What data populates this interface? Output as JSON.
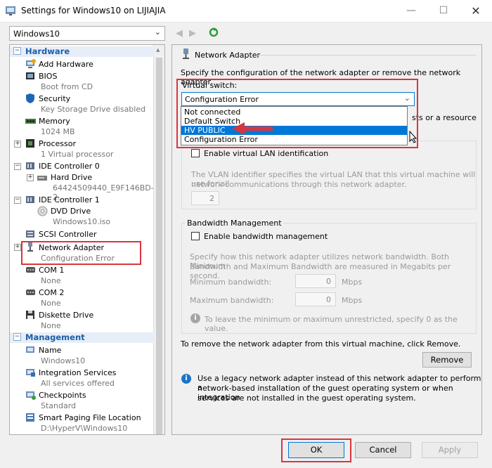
{
  "window": {
    "title": "Settings for Windows10 on LIJIAJIA"
  },
  "vm_selector": {
    "value": "Windows10"
  },
  "tree": {
    "hardware_label": "Hardware",
    "management_label": "Management",
    "items": [
      {
        "label": "Add Hardware",
        "sub": ""
      },
      {
        "label": "BIOS",
        "sub": "Boot from CD"
      },
      {
        "label": "Security",
        "sub": "Key Storage Drive disabled"
      },
      {
        "label": "Memory",
        "sub": "1024 MB"
      },
      {
        "label": "Processor",
        "sub": "1 Virtual processor"
      },
      {
        "label": "IDE Controller 0",
        "sub": ""
      },
      {
        "label": "Hard Drive",
        "sub": "64424509440_E9F146BD-2..."
      },
      {
        "label": "IDE Controller 1",
        "sub": ""
      },
      {
        "label": "DVD Drive",
        "sub": "Windows10.iso"
      },
      {
        "label": "SCSI Controller",
        "sub": ""
      },
      {
        "label": "Network Adapter",
        "sub": "Configuration Error"
      },
      {
        "label": "COM 1",
        "sub": "None"
      },
      {
        "label": "COM 2",
        "sub": "None"
      },
      {
        "label": "Diskette Drive",
        "sub": "None"
      }
    ],
    "mgmt_items": [
      {
        "label": "Name",
        "sub": "Windows10"
      },
      {
        "label": "Integration Services",
        "sub": "All services offered"
      },
      {
        "label": "Checkpoints",
        "sub": "Standard"
      },
      {
        "label": "Smart Paging File Location",
        "sub": "D:\\HyperV\\Windows10"
      }
    ]
  },
  "panel": {
    "section_title": "Network Adapter",
    "description": "Specify the configuration of the network adapter or remove the network adapter.",
    "virtual_switch_label": "Virtual switch:",
    "virtual_switch_value": "Configuration Error",
    "dropdown_options": [
      "Not connected",
      "Default Switch",
      "HV PUBLIC",
      "Configuration Error"
    ],
    "dropdown_selected": "HV PUBLIC",
    "hidden_text_fragment": "sts or a resource",
    "vlan_checkbox": "Enable virtual LAN identification",
    "vlan_desc_1": "The VLAN identifier specifies the virtual LAN that this virtual machine will use for all",
    "vlan_desc_2": "network communications through this network adapter.",
    "vlan_value": "2",
    "bandwidth_group": "Bandwidth Management",
    "bandwidth_checkbox": "Enable bandwidth management",
    "bw_desc_1": "Specify how this network adapter utilizes network bandwidth. Both Minimum",
    "bw_desc_2": "Bandwidth and Maximum Bandwidth are measured in Megabits per second.",
    "min_label": "Minimum bandwidth:",
    "max_label": "Maximum bandwidth:",
    "min_value": "0",
    "max_value": "0",
    "unit": "Mbps",
    "bw_note": "To leave the minimum or maximum unrestricted, specify 0 as the value.",
    "remove_desc": "To remove the network adapter from this virtual machine, click Remove.",
    "remove_button": "Remove",
    "legacy_1": "Use a legacy network adapter instead of this network adapter to perform a",
    "legacy_2": "network-based installation of the guest operating system or when integration",
    "legacy_3": "services are not installed in the guest operating system."
  },
  "buttons": {
    "ok": "OK",
    "cancel": "Cancel",
    "apply": "Apply"
  },
  "colors": {
    "highlight": "#d9353d",
    "accent": "#0078d7"
  }
}
